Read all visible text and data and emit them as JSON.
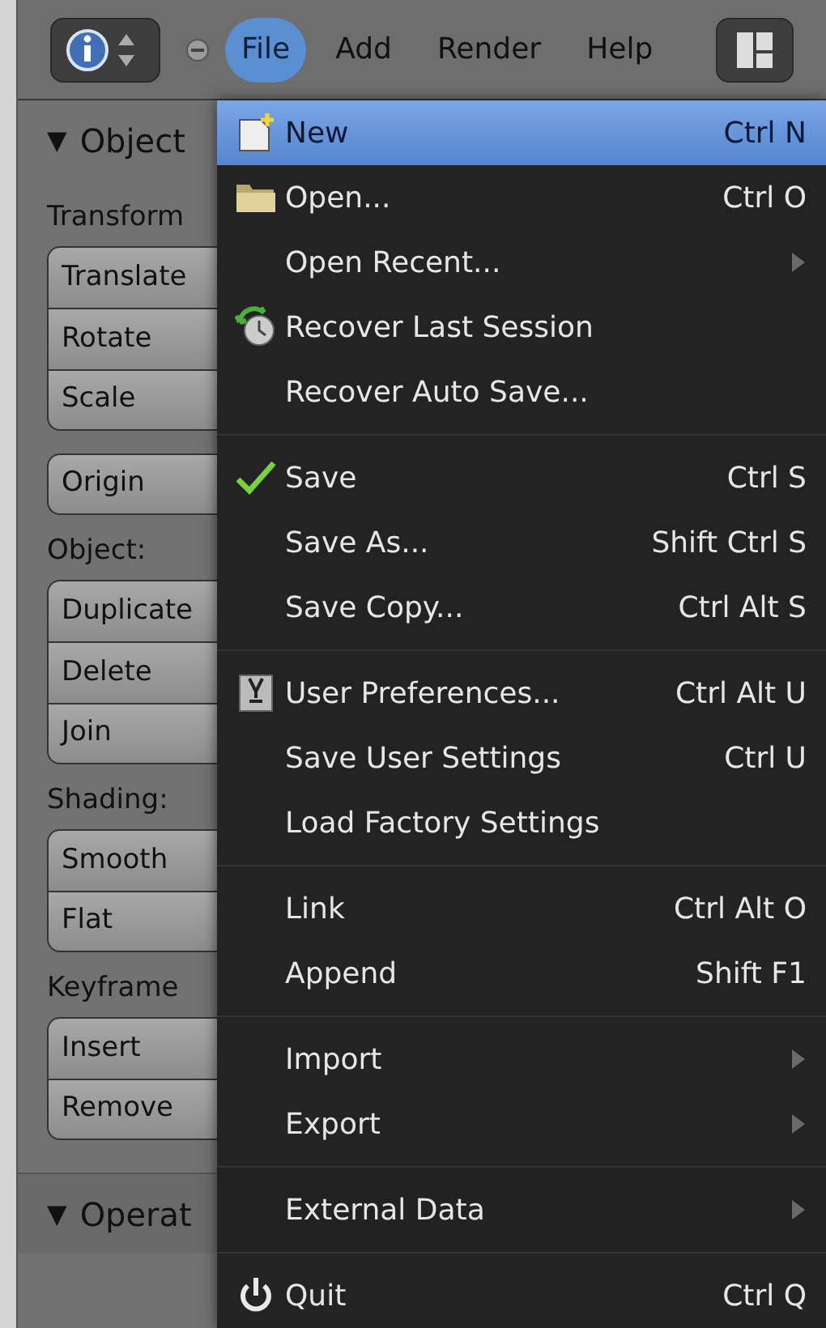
{
  "header": {
    "menus": [
      {
        "label": "File",
        "selected": true
      },
      {
        "label": "Add",
        "selected": false
      },
      {
        "label": "Render",
        "selected": false
      },
      {
        "label": "Help",
        "selected": false
      }
    ]
  },
  "panel": {
    "toggle": "▼",
    "title": "Object",
    "groups": [
      {
        "label": "Transform",
        "buttons": [
          "Translate",
          "Rotate",
          "Scale"
        ]
      },
      {
        "buttons": [
          "Origin"
        ]
      },
      {
        "label": "Object:",
        "buttons": [
          "Duplicate",
          "Delete",
          "Join"
        ]
      },
      {
        "label": "Shading:",
        "buttons": [
          "Smooth",
          "Flat"
        ]
      },
      {
        "label": "Keyframe",
        "buttons": [
          "Insert",
          "Remove"
        ]
      }
    ],
    "next_toggle": "▼",
    "next_title": "Operat"
  },
  "file_menu": {
    "sections": [
      {
        "items": [
          {
            "label": "New",
            "shortcut": "Ctrl N",
            "kind": "new",
            "selected": true,
            "submenu": false
          },
          {
            "label": "Open...",
            "shortcut": "Ctrl O",
            "kind": "open",
            "selected": false,
            "submenu": false
          },
          {
            "label": "Open Recent...",
            "selected": false,
            "submenu": true
          },
          {
            "label": "Recover Last Session",
            "kind": "recover",
            "selected": false,
            "submenu": false
          },
          {
            "label": "Recover Auto Save...",
            "selected": false,
            "submenu": false
          }
        ]
      },
      {
        "items": [
          {
            "label": "Save",
            "shortcut": "Ctrl S",
            "kind": "check",
            "selected": false,
            "submenu": false
          },
          {
            "label": "Save As...",
            "shortcut": "Shift Ctrl S",
            "selected": false,
            "submenu": false
          },
          {
            "label": "Save Copy...",
            "shortcut": "Ctrl Alt S",
            "selected": false,
            "submenu": false
          }
        ]
      },
      {
        "items": [
          {
            "label": "User Preferences...",
            "shortcut": "Ctrl Alt U",
            "kind": "preferences",
            "selected": false,
            "submenu": false
          },
          {
            "label": "Save User Settings",
            "shortcut": "Ctrl U",
            "selected": false,
            "submenu": false
          },
          {
            "label": "Load Factory Settings",
            "selected": false,
            "submenu": false
          }
        ]
      },
      {
        "items": [
          {
            "label": "Link",
            "shortcut": "Ctrl Alt O",
            "selected": false,
            "submenu": false
          },
          {
            "label": "Append",
            "shortcut": "Shift F1",
            "selected": false,
            "submenu": false
          }
        ]
      },
      {
        "items": [
          {
            "label": "Import",
            "selected": false,
            "submenu": true
          },
          {
            "label": "Export",
            "selected": false,
            "submenu": true
          }
        ]
      },
      {
        "items": [
          {
            "label": "External Data",
            "selected": false,
            "submenu": true
          }
        ]
      },
      {
        "items": [
          {
            "label": "Quit",
            "shortcut": "Ctrl Q",
            "kind": "quit",
            "selected": false,
            "submenu": false
          }
        ]
      }
    ]
  }
}
